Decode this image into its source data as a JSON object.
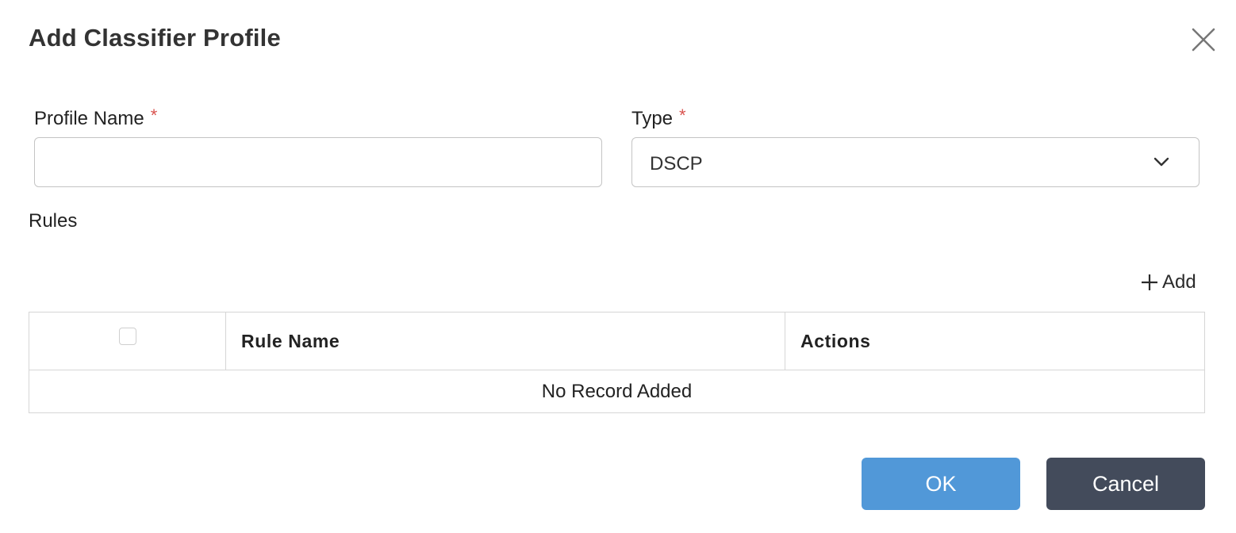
{
  "dialog": {
    "title": "Add Classifier Profile",
    "close_icon": "close-icon"
  },
  "form": {
    "profile_name": {
      "label": "Profile Name",
      "required_mark": "*",
      "value": "",
      "placeholder": ""
    },
    "type": {
      "label": "Type",
      "required_mark": "*",
      "selected": "DSCP",
      "icon": "chevron-down-icon"
    }
  },
  "rules": {
    "label": "Rules",
    "add_label": "Add",
    "add_icon": "plus-icon",
    "columns": [
      "",
      "Rule Name",
      "Actions"
    ],
    "rows": [],
    "empty_message": "No Record Added"
  },
  "footer": {
    "ok_label": "OK",
    "cancel_label": "Cancel"
  },
  "colors": {
    "primary": "#5198d8",
    "secondary": "#434b5b",
    "required": "#d9534f",
    "border": "#c4c4c4"
  }
}
